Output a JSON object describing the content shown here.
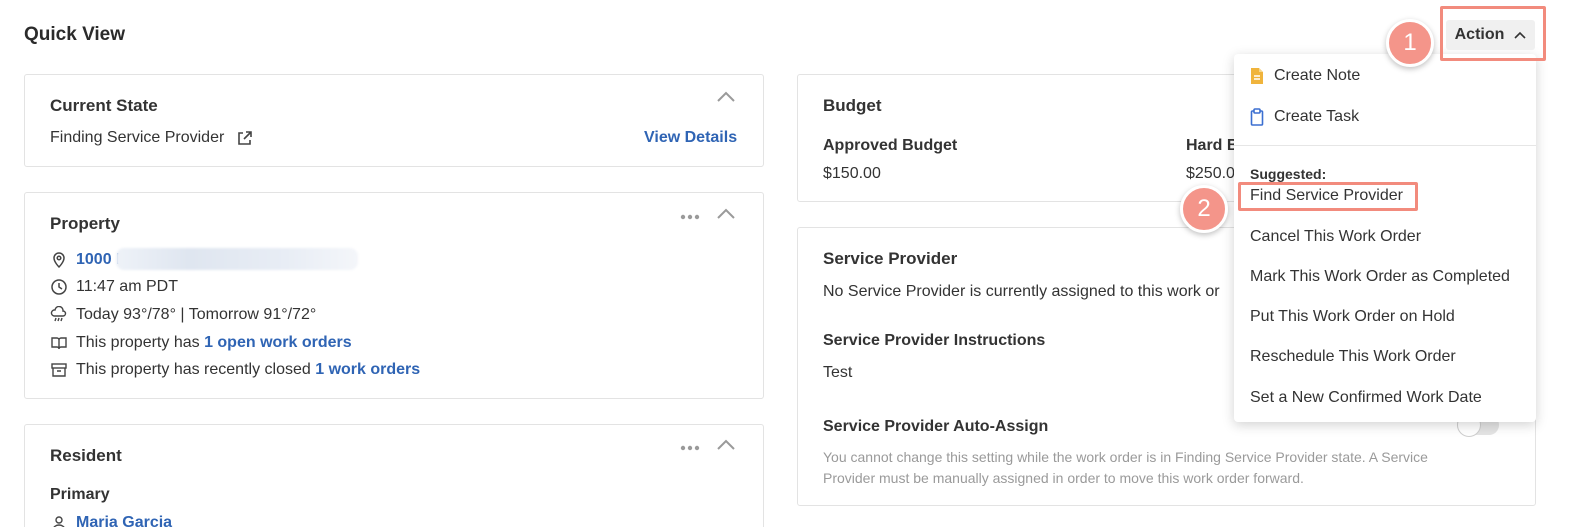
{
  "page": {
    "title": "Quick View"
  },
  "current_state": {
    "title": "Current State",
    "value": "Finding Service Provider",
    "view_details": "View Details"
  },
  "property": {
    "title": "Property",
    "address": "1000 F",
    "time": "11:47 am PDT",
    "weather": "Today 93°/78° | Tomorrow 91°/72°",
    "open_prefix": "This property has ",
    "open_link": "1 open work orders",
    "closed_prefix": "This property has recently closed ",
    "closed_link": "1 work orders"
  },
  "resident": {
    "title": "Resident",
    "primary_label": "Primary",
    "name": "Maria Garcia"
  },
  "budget": {
    "title": "Budget",
    "approved_label": "Approved Budget",
    "approved_value": "$150.00",
    "hard_label": "Hard B",
    "hard_value": "$250.0"
  },
  "service_provider": {
    "title": "Service Provider",
    "none_text": "No Service Provider is currently assigned to this work or",
    "instructions_label": "Service Provider Instructions",
    "instructions_value": "Test",
    "auto_assign_label": "Service Provider Auto-Assign",
    "auto_assign_on": false,
    "help_text": "You cannot change this setting while the work order is in Finding Service Provider state. A Service Provider must be manually assigned in order to move this work order forward."
  },
  "action": {
    "label": "Action",
    "menu": {
      "create_note": "Create Note",
      "create_task": "Create Task",
      "suggested_label": "Suggested:",
      "items": [
        "Find Service Provider",
        "Cancel This Work Order",
        "Mark This Work Order as Completed",
        "Put This Work Order on Hold",
        "Reschedule This Work Order",
        "Set a New Confirmed Work Date"
      ]
    }
  },
  "annotations": {
    "step1": "1",
    "step2": "2"
  },
  "colors": {
    "link": "#2f64b4",
    "highlight": "#f28b7d",
    "step_badge": "#f4958a",
    "note_icon": "#f0b43c"
  }
}
